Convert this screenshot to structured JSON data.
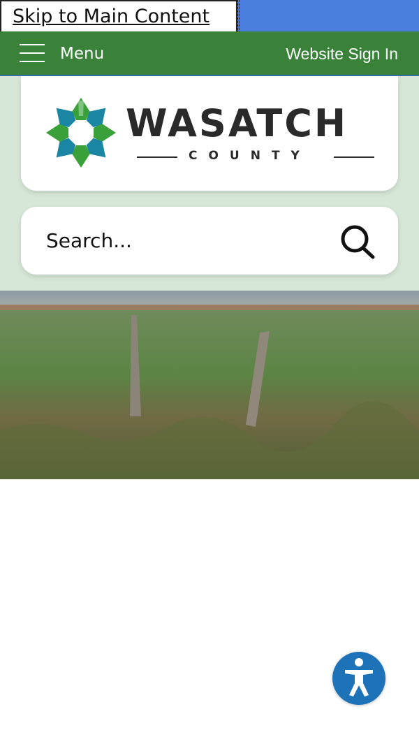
{
  "skip_link": {
    "label": "Skip to Main Content"
  },
  "menubar": {
    "menu_label": "Menu",
    "signin_label": "Website Sign In",
    "background": "#3a823a"
  },
  "logo": {
    "name": "WASATCH",
    "subtitle": "COUNTY",
    "colors": {
      "green": "#3aa13a",
      "teal": "#1b86a4",
      "text": "#2a2a2a"
    }
  },
  "search": {
    "placeholder": "Search..."
  },
  "colors": {
    "header_band": "#d7e7d7",
    "accessibility": "#1e72b8"
  },
  "icons": {
    "menu": "hamburger-icon",
    "search": "magnifier-icon",
    "accessibility": "accessibility-person-icon"
  }
}
